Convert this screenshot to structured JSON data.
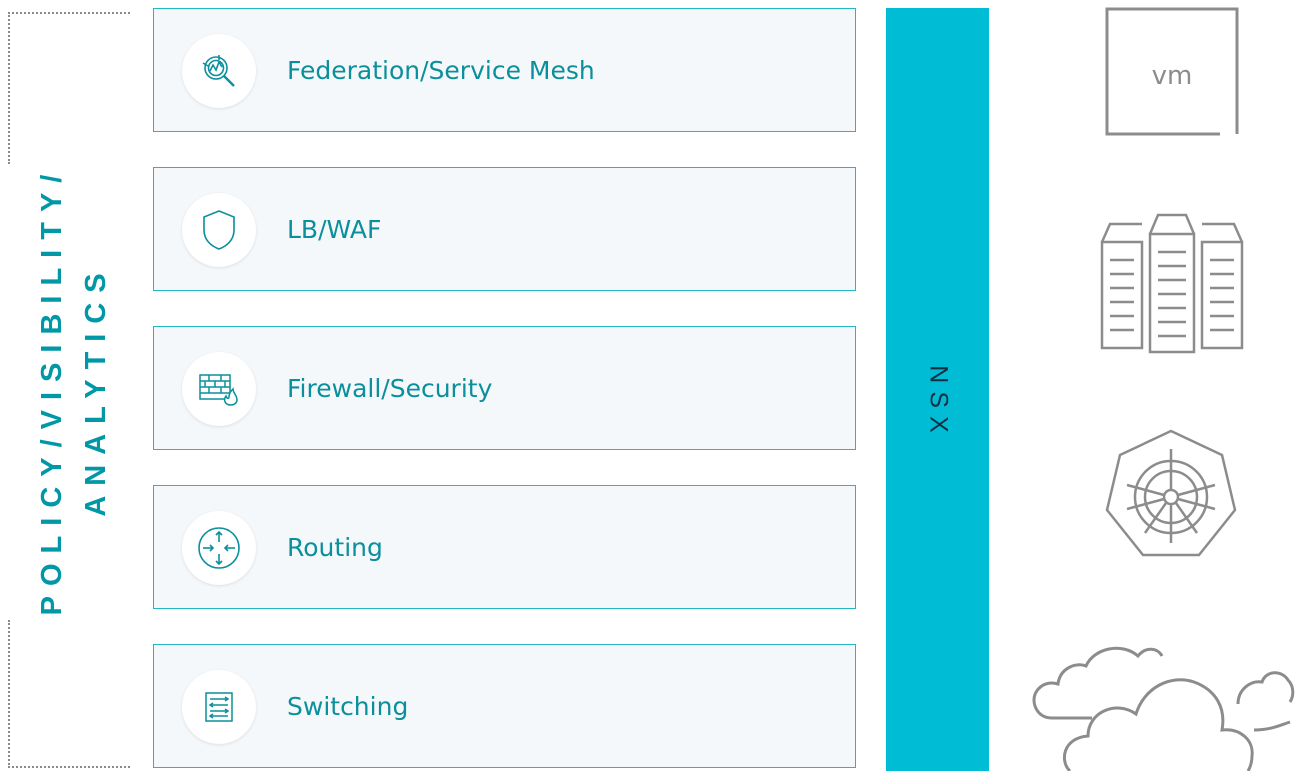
{
  "side_label": {
    "line1": "POLICY/VISIBILITY/",
    "line2": "ANALYTICS"
  },
  "layers": [
    {
      "label": "Federation/Service Mesh",
      "icon": "service-mesh-icon"
    },
    {
      "label": "LB/WAF",
      "icon": "shield-icon"
    },
    {
      "label": "Firewall/Security",
      "icon": "firewall-icon"
    },
    {
      "label": "Routing",
      "icon": "router-icon"
    },
    {
      "label": "Switching",
      "icon": "switch-icon"
    }
  ],
  "nsx_bar": {
    "label": "NSX"
  },
  "workloads": [
    {
      "icon": "vm-icon",
      "text": "vm"
    },
    {
      "icon": "servers-icon"
    },
    {
      "icon": "kubernetes-icon"
    },
    {
      "icon": "cloud-icon"
    }
  ],
  "colors": {
    "accent": "#23b7c6",
    "label_teal": "#0a8f9c",
    "side_label": "#0097a7",
    "nsx_bar": "#00bcd4",
    "nsx_text": "#0e2f44",
    "layer_bg": "#f5f8fa",
    "workload_gray": "#8c8c8c"
  }
}
